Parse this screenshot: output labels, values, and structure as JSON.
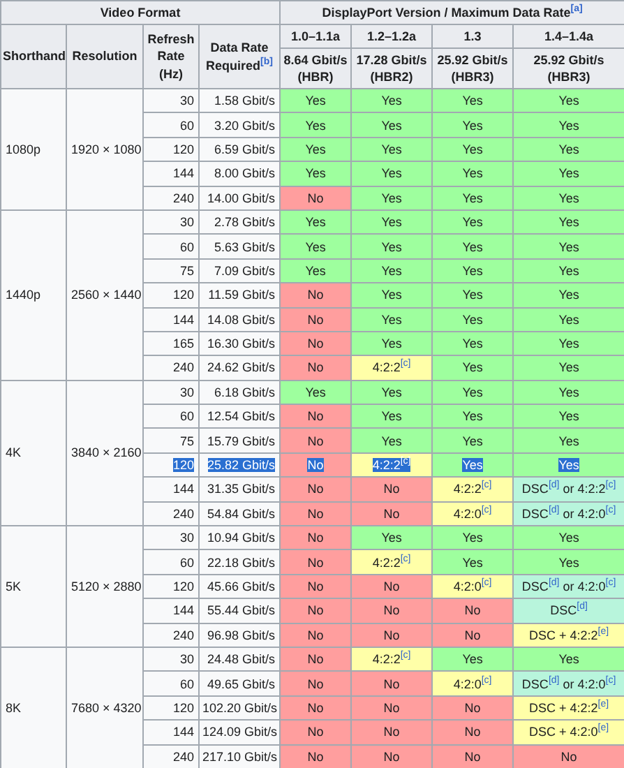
{
  "header": {
    "video_format": "Video Format",
    "dp_title": "DisplayPort Version / Maximum Data Rate$^{[a]}$",
    "columns": [
      "Shorthand",
      "Resolution",
      "Refresh Rate (Hz)",
      "Data Rate Required$^{[b]}$"
    ],
    "versions": [
      {
        "version": "1.0–1.1a",
        "rate": "8.64 Gbit/s",
        "mode": "(HBR)"
      },
      {
        "version": "1.2–1.2a",
        "rate": "17.28 Gbit/s",
        "mode": "(HBR2)"
      },
      {
        "version": "1.3",
        "rate": "25.92 Gbit/s",
        "mode": "(HBR3)"
      },
      {
        "version": "1.4–1.4a",
        "rate": "25.92 Gbit/s",
        "mode": "(HBR3)"
      }
    ]
  },
  "groups": [
    {
      "shorthand": "1080p",
      "resolution": "1920 × 1080",
      "rows": [
        {
          "rate": "30",
          "data_rate": "1.58 Gbit/s",
          "selected": false,
          "support": [
            {
              "text": "Yes",
              "kind": "yes"
            },
            {
              "text": "Yes",
              "kind": "yes"
            },
            {
              "text": "Yes",
              "kind": "yes"
            },
            {
              "text": "Yes",
              "kind": "yes"
            }
          ]
        },
        {
          "rate": "60",
          "data_rate": "3.20 Gbit/s",
          "selected": false,
          "support": [
            {
              "text": "Yes",
              "kind": "yes"
            },
            {
              "text": "Yes",
              "kind": "yes"
            },
            {
              "text": "Yes",
              "kind": "yes"
            },
            {
              "text": "Yes",
              "kind": "yes"
            }
          ]
        },
        {
          "rate": "120",
          "data_rate": "6.59 Gbit/s",
          "selected": false,
          "support": [
            {
              "text": "Yes",
              "kind": "yes"
            },
            {
              "text": "Yes",
              "kind": "yes"
            },
            {
              "text": "Yes",
              "kind": "yes"
            },
            {
              "text": "Yes",
              "kind": "yes"
            }
          ]
        },
        {
          "rate": "144",
          "data_rate": "8.00 Gbit/s",
          "selected": false,
          "support": [
            {
              "text": "Yes",
              "kind": "yes"
            },
            {
              "text": "Yes",
              "kind": "yes"
            },
            {
              "text": "Yes",
              "kind": "yes"
            },
            {
              "text": "Yes",
              "kind": "yes"
            }
          ]
        },
        {
          "rate": "240",
          "data_rate": "14.00 Gbit/s",
          "selected": false,
          "support": [
            {
              "text": "No",
              "kind": "no"
            },
            {
              "text": "Yes",
              "kind": "yes"
            },
            {
              "text": "Yes",
              "kind": "yes"
            },
            {
              "text": "Yes",
              "kind": "yes"
            }
          ]
        }
      ]
    },
    {
      "shorthand": "1440p",
      "resolution": "2560 × 1440",
      "rows": [
        {
          "rate": "30",
          "data_rate": "2.78 Gbit/s",
          "selected": false,
          "support": [
            {
              "text": "Yes",
              "kind": "yes"
            },
            {
              "text": "Yes",
              "kind": "yes"
            },
            {
              "text": "Yes",
              "kind": "yes"
            },
            {
              "text": "Yes",
              "kind": "yes"
            }
          ]
        },
        {
          "rate": "60",
          "data_rate": "5.63 Gbit/s",
          "selected": false,
          "support": [
            {
              "text": "Yes",
              "kind": "yes"
            },
            {
              "text": "Yes",
              "kind": "yes"
            },
            {
              "text": "Yes",
              "kind": "yes"
            },
            {
              "text": "Yes",
              "kind": "yes"
            }
          ]
        },
        {
          "rate": "75",
          "data_rate": "7.09 Gbit/s",
          "selected": false,
          "support": [
            {
              "text": "Yes",
              "kind": "yes"
            },
            {
              "text": "Yes",
              "kind": "yes"
            },
            {
              "text": "Yes",
              "kind": "yes"
            },
            {
              "text": "Yes",
              "kind": "yes"
            }
          ]
        },
        {
          "rate": "120",
          "data_rate": "11.59 Gbit/s",
          "selected": false,
          "support": [
            {
              "text": "No",
              "kind": "no"
            },
            {
              "text": "Yes",
              "kind": "yes"
            },
            {
              "text": "Yes",
              "kind": "yes"
            },
            {
              "text": "Yes",
              "kind": "yes"
            }
          ]
        },
        {
          "rate": "144",
          "data_rate": "14.08 Gbit/s",
          "selected": false,
          "support": [
            {
              "text": "No",
              "kind": "no"
            },
            {
              "text": "Yes",
              "kind": "yes"
            },
            {
              "text": "Yes",
              "kind": "yes"
            },
            {
              "text": "Yes",
              "kind": "yes"
            }
          ]
        },
        {
          "rate": "165",
          "data_rate": "16.30 Gbit/s",
          "selected": false,
          "support": [
            {
              "text": "No",
              "kind": "no"
            },
            {
              "text": "Yes",
              "kind": "yes"
            },
            {
              "text": "Yes",
              "kind": "yes"
            },
            {
              "text": "Yes",
              "kind": "yes"
            }
          ]
        },
        {
          "rate": "240",
          "data_rate": "24.62 Gbit/s",
          "selected": false,
          "support": [
            {
              "text": "No",
              "kind": "no"
            },
            {
              "text": "4:2:2$^{[c]}$",
              "kind": "partial"
            },
            {
              "text": "Yes",
              "kind": "yes"
            },
            {
              "text": "Yes",
              "kind": "yes"
            }
          ]
        }
      ]
    },
    {
      "shorthand": "4K",
      "resolution": "3840 × 2160",
      "rows": [
        {
          "rate": "30",
          "data_rate": "6.18 Gbit/s",
          "selected": false,
          "support": [
            {
              "text": "Yes",
              "kind": "yes"
            },
            {
              "text": "Yes",
              "kind": "yes"
            },
            {
              "text": "Yes",
              "kind": "yes"
            },
            {
              "text": "Yes",
              "kind": "yes"
            }
          ]
        },
        {
          "rate": "60",
          "data_rate": "12.54 Gbit/s",
          "selected": false,
          "support": [
            {
              "text": "No",
              "kind": "no"
            },
            {
              "text": "Yes",
              "kind": "yes"
            },
            {
              "text": "Yes",
              "kind": "yes"
            },
            {
              "text": "Yes",
              "kind": "yes"
            }
          ]
        },
        {
          "rate": "75",
          "data_rate": "15.79 Gbit/s",
          "selected": false,
          "support": [
            {
              "text": "No",
              "kind": "no"
            },
            {
              "text": "Yes",
              "kind": "yes"
            },
            {
              "text": "Yes",
              "kind": "yes"
            },
            {
              "text": "Yes",
              "kind": "yes"
            }
          ]
        },
        {
          "rate": "120",
          "data_rate": "25.82 Gbit/s",
          "selected": true,
          "support": [
            {
              "text": "No",
              "kind": "no"
            },
            {
              "text": "4:2:2$^{[c]}$",
              "kind": "partial"
            },
            {
              "text": "Yes",
              "kind": "yes"
            },
            {
              "text": "Yes",
              "kind": "yes"
            }
          ]
        },
        {
          "rate": "144",
          "data_rate": "31.35 Gbit/s",
          "selected": false,
          "support": [
            {
              "text": "No",
              "kind": "no"
            },
            {
              "text": "No",
              "kind": "no"
            },
            {
              "text": "4:2:2$^{[c]}$",
              "kind": "partial"
            },
            {
              "text": "DSC$^{[d]}$ or 4:2:2$^{[c]}$",
              "kind": "dsc"
            }
          ]
        },
        {
          "rate": "240",
          "data_rate": "54.84 Gbit/s",
          "selected": false,
          "support": [
            {
              "text": "No",
              "kind": "no"
            },
            {
              "text": "No",
              "kind": "no"
            },
            {
              "text": "4:2:0$^{[c]}$",
              "kind": "partial"
            },
            {
              "text": "DSC$^{[d]}$ or 4:2:0$^{[c]}$",
              "kind": "dsc"
            }
          ]
        }
      ]
    },
    {
      "shorthand": "5K",
      "resolution": "5120 × 2880",
      "rows": [
        {
          "rate": "30",
          "data_rate": "10.94 Gbit/s",
          "selected": false,
          "support": [
            {
              "text": "No",
              "kind": "no"
            },
            {
              "text": "Yes",
              "kind": "yes"
            },
            {
              "text": "Yes",
              "kind": "yes"
            },
            {
              "text": "Yes",
              "kind": "yes"
            }
          ]
        },
        {
          "rate": "60",
          "data_rate": "22.18 Gbit/s",
          "selected": false,
          "support": [
            {
              "text": "No",
              "kind": "no"
            },
            {
              "text": "4:2:2$^{[c]}$",
              "kind": "partial"
            },
            {
              "text": "Yes",
              "kind": "yes"
            },
            {
              "text": "Yes",
              "kind": "yes"
            }
          ]
        },
        {
          "rate": "120",
          "data_rate": "45.66 Gbit/s",
          "selected": false,
          "support": [
            {
              "text": "No",
              "kind": "no"
            },
            {
              "text": "No",
              "kind": "no"
            },
            {
              "text": "4:2:0$^{[c]}$",
              "kind": "partial"
            },
            {
              "text": "DSC$^{[d]}$ or 4:2:0$^{[c]}$",
              "kind": "dsc"
            }
          ]
        },
        {
          "rate": "144",
          "data_rate": "55.44 Gbit/s",
          "selected": false,
          "support": [
            {
              "text": "No",
              "kind": "no"
            },
            {
              "text": "No",
              "kind": "no"
            },
            {
              "text": "No",
              "kind": "no"
            },
            {
              "text": "DSC$^{[d]}$",
              "kind": "dsc"
            }
          ]
        },
        {
          "rate": "240",
          "data_rate": "96.98 Gbit/s",
          "selected": false,
          "support": [
            {
              "text": "No",
              "kind": "no"
            },
            {
              "text": "No",
              "kind": "no"
            },
            {
              "text": "No",
              "kind": "no"
            },
            {
              "text": "DSC + 4:2:2$^{[e]}$",
              "kind": "partial"
            }
          ]
        }
      ]
    },
    {
      "shorthand": "8K",
      "resolution": "7680 × 4320",
      "rows": [
        {
          "rate": "30",
          "data_rate": "24.48 Gbit/s",
          "selected": false,
          "support": [
            {
              "text": "No",
              "kind": "no"
            },
            {
              "text": "4:2:2$^{[c]}$",
              "kind": "partial"
            },
            {
              "text": "Yes",
              "kind": "yes"
            },
            {
              "text": "Yes",
              "kind": "yes"
            }
          ]
        },
        {
          "rate": "60",
          "data_rate": "49.65 Gbit/s",
          "selected": false,
          "support": [
            {
              "text": "No",
              "kind": "no"
            },
            {
              "text": "No",
              "kind": "no"
            },
            {
              "text": "4:2:0$^{[c]}$",
              "kind": "partial"
            },
            {
              "text": "DSC$^{[d]}$ or 4:2:0$^{[c]}$",
              "kind": "dsc"
            }
          ]
        },
        {
          "rate": "120",
          "data_rate": "102.20 Gbit/s",
          "selected": false,
          "support": [
            {
              "text": "No",
              "kind": "no"
            },
            {
              "text": "No",
              "kind": "no"
            },
            {
              "text": "No",
              "kind": "no"
            },
            {
              "text": "DSC + 4:2:2$^{[e]}$",
              "kind": "partial"
            }
          ]
        },
        {
          "rate": "144",
          "data_rate": "124.09 Gbit/s",
          "selected": false,
          "support": [
            {
              "text": "No",
              "kind": "no"
            },
            {
              "text": "No",
              "kind": "no"
            },
            {
              "text": "No",
              "kind": "no"
            },
            {
              "text": "DSC + 4:2:0$^{[e]}$",
              "kind": "partial"
            }
          ]
        },
        {
          "rate": "240",
          "data_rate": "217.10 Gbit/s",
          "selected": false,
          "support": [
            {
              "text": "No",
              "kind": "no"
            },
            {
              "text": "No",
              "kind": "no"
            },
            {
              "text": "No",
              "kind": "no"
            },
            {
              "text": "No",
              "kind": "no"
            }
          ]
        }
      ]
    }
  ]
}
